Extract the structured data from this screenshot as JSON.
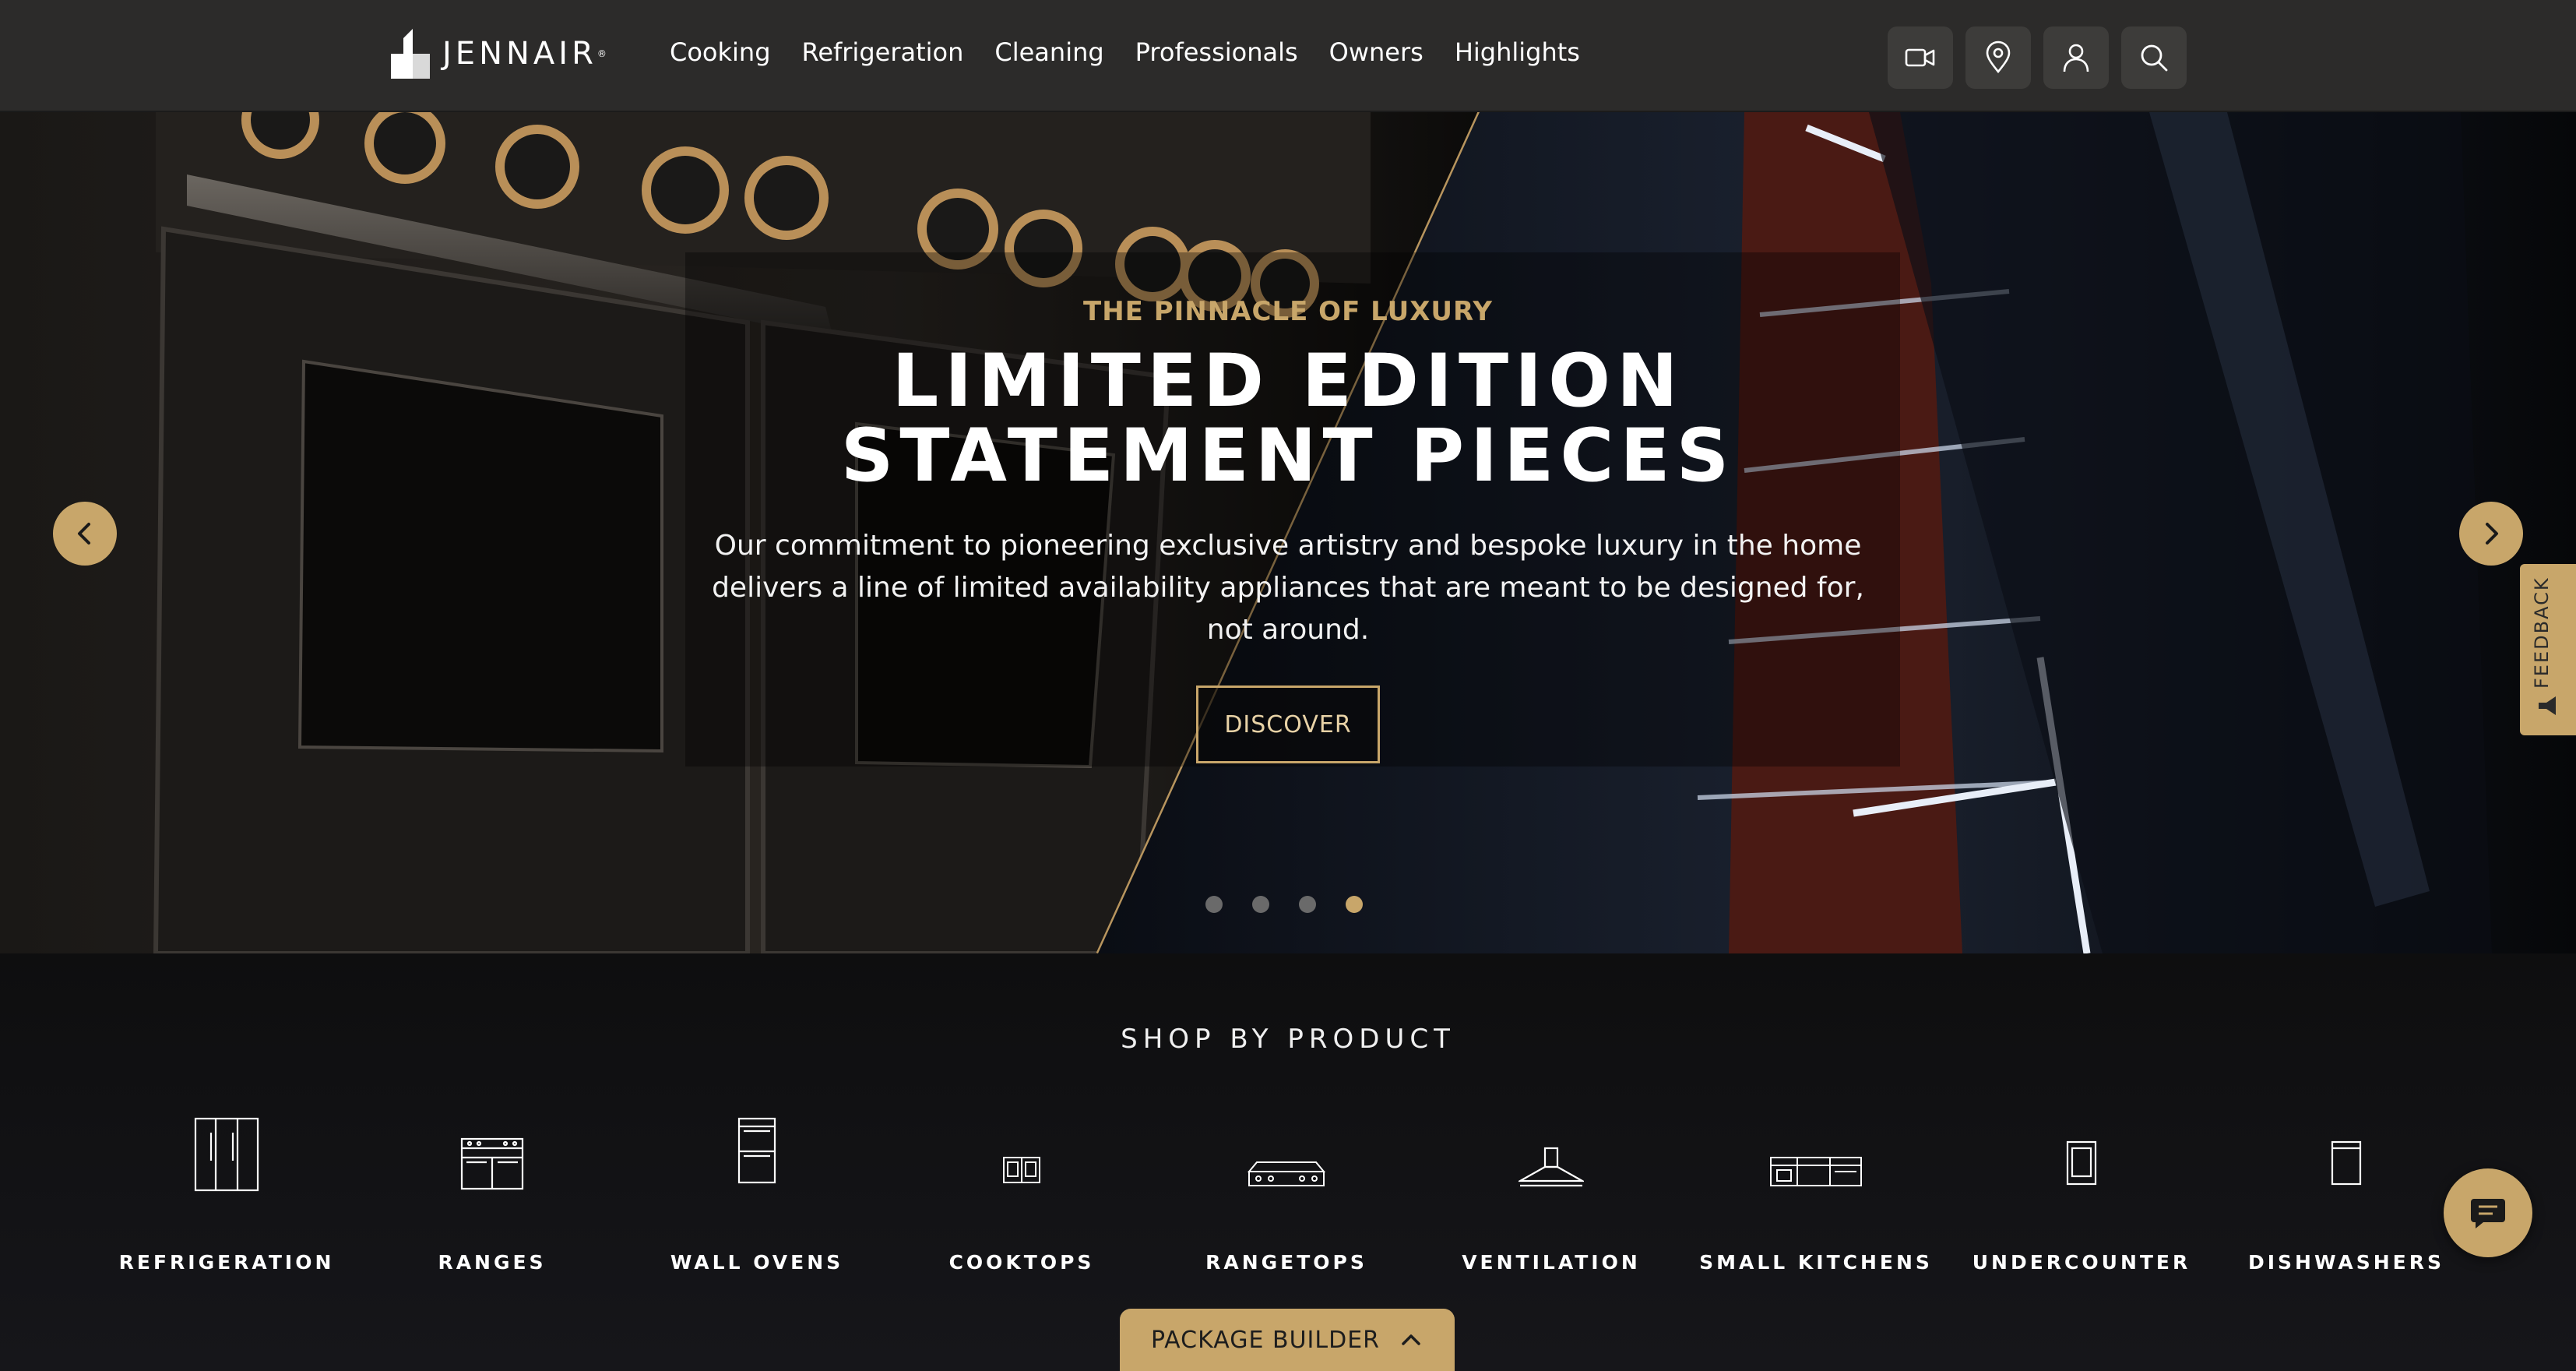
{
  "header": {
    "brand": "JENNAIR",
    "nav": [
      {
        "label": "Cooking"
      },
      {
        "label": "Refrigeration"
      },
      {
        "label": "Cleaning"
      },
      {
        "label": "Professionals"
      },
      {
        "label": "Owners"
      },
      {
        "label": "Highlights"
      }
    ],
    "icons": [
      "video-camera-icon",
      "location-pin-icon",
      "user-icon",
      "search-icon"
    ]
  },
  "hero": {
    "eyebrow": "THE PINNACLE OF LUXURY",
    "headline_line1": "LIMITED EDITION",
    "headline_line2": "STATEMENT PIECES",
    "subcopy": "Our commitment to pioneering exclusive artistry and bespoke luxury in the home delivers a line of limited availability appliances that are meant to be designed for, not around.",
    "cta": "DISCOVER",
    "slide_count": 4,
    "active_slide": 4
  },
  "feedback": {
    "label": "FEEDBACK"
  },
  "shop": {
    "title": "SHOP BY PRODUCT",
    "products": [
      {
        "label": "REFRIGERATION",
        "icon": "refrigerator-icon"
      },
      {
        "label": "RANGES",
        "icon": "range-icon"
      },
      {
        "label": "WALL OVENS",
        "icon": "wall-oven-icon"
      },
      {
        "label": "COOKTOPS",
        "icon": "cooktop-icon"
      },
      {
        "label": "RANGETOPS",
        "icon": "rangetop-icon"
      },
      {
        "label": "VENTILATION",
        "icon": "range-hood-icon"
      },
      {
        "label": "SMALL KITCHENS",
        "icon": "small-kitchen-icon"
      },
      {
        "label": "UNDERCOUNTER",
        "icon": "undercounter-icon"
      },
      {
        "label": "DISHWASHERS",
        "icon": "dishwasher-icon"
      }
    ]
  },
  "package_builder": {
    "label": "PACKAGE BUILDER"
  },
  "colors": {
    "accent": "#c8a66a",
    "header_bg": "#2c2b2a",
    "page_bg": "#0f0f10"
  }
}
